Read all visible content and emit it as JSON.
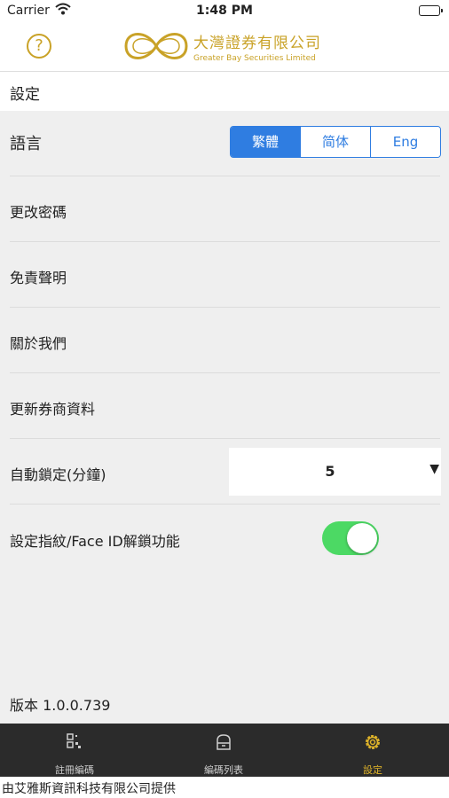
{
  "status_bar": {
    "carrier": "Carrier",
    "time": "1:48 PM"
  },
  "header": {
    "help_glyph": "?",
    "brand_zh": "大灣證券有限公司",
    "brand_en": "Greater Bay Securities Limited",
    "accent": "#c9a227"
  },
  "page_title": "設定",
  "settings": {
    "language": {
      "label": "語言",
      "options": [
        "繁體",
        "简体",
        "Eng"
      ],
      "selected": "繁體"
    },
    "change_password": "更改密碼",
    "disclaimer": "免責聲明",
    "about_us": "關於我們",
    "update_broker": "更新券商資料",
    "auto_lock": {
      "label": "自動鎖定(分鐘)",
      "value": "5"
    },
    "biometric": {
      "label": "設定指紋/Face ID解鎖功能",
      "enabled": true
    }
  },
  "version_text": "版本 1.0.0.739",
  "tabs": [
    {
      "label": "註冊編碼",
      "icon": "qr-scan-icon",
      "active": false
    },
    {
      "label": "編碼列表",
      "icon": "archive-box-icon",
      "active": false
    },
    {
      "label": "設定",
      "icon": "gear-icon",
      "active": true
    }
  ],
  "footer_text": "由艾雅斯資訊科技有限公司提供",
  "colors": {
    "segment_blue": "#2f7de1",
    "toggle_green": "#4cd964",
    "tab_active": "#e0b429",
    "tab_bg": "#2b2b2b"
  }
}
